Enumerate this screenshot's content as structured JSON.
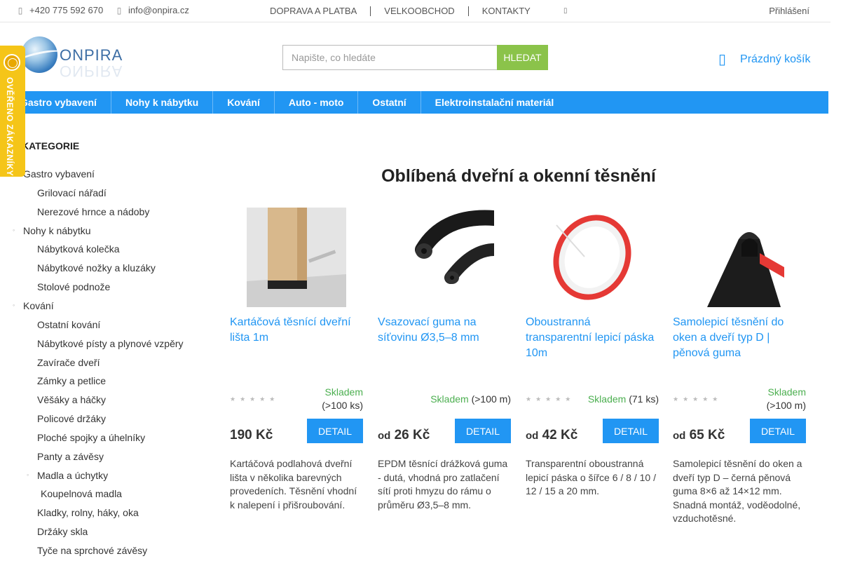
{
  "topbar": {
    "phone": "+420 775 592 670",
    "email": "info@onpira.cz",
    "nav": [
      "DOPRAVA A PLATBA",
      "VELKOOBCHOD",
      "KONTAKTY"
    ],
    "login": "Přihlášení"
  },
  "logo": {
    "name": "ONPIRA"
  },
  "search": {
    "placeholder": "Napište, co hledáte",
    "button": "HLEDAT"
  },
  "cart": {
    "label": "Prázdný košík"
  },
  "mainnav": [
    "Gastro vybavení",
    "Nohy k nábytku",
    "Kování",
    "Auto - moto",
    "Ostatní",
    "Elektroinstalační materiál"
  ],
  "badge": {
    "text": "OVĚŘENO ZÁKAZNÍKY"
  },
  "sidebar": {
    "heading": "KATEGORIE",
    "items": [
      {
        "label": "Gastro vybavení",
        "level": 0
      },
      {
        "label": "Grilovací nářadí",
        "level": 1
      },
      {
        "label": "Nerezové hrnce a nádoby",
        "level": 1
      },
      {
        "label": "Nohy k nábytku",
        "level": 0
      },
      {
        "label": "Nábytková kolečka",
        "level": 1
      },
      {
        "label": "Nábytkové nožky a kluzáky",
        "level": 1
      },
      {
        "label": "Stolové podnože",
        "level": 1
      },
      {
        "label": "Kování",
        "level": 0
      },
      {
        "label": "Ostatní kování",
        "level": 1
      },
      {
        "label": "Nábytkové písty a plynové vzpěry",
        "level": 1
      },
      {
        "label": "Zavírače dveří",
        "level": 1
      },
      {
        "label": "Zámky a petlice",
        "level": 1
      },
      {
        "label": "Věšáky a háčky",
        "level": 1
      },
      {
        "label": "Policové držáky",
        "level": 1
      },
      {
        "label": "Ploché spojky a úhelníky",
        "level": 1
      },
      {
        "label": "Panty a závěsy",
        "level": 1
      },
      {
        "label": "Madla a úchytky",
        "level": 1
      },
      {
        "label": "Koupelnová madla",
        "level": 2
      },
      {
        "label": "Kladky, rolny, háky, oka",
        "level": 1
      },
      {
        "label": "Držáky skla",
        "level": 1
      },
      {
        "label": "Tyče na sprchové závěsy",
        "level": 1
      }
    ]
  },
  "content": {
    "title": "Oblíbená dveřní a okenní těsnění",
    "products": [
      {
        "name": "Kartáčová těsnící dveřní lišta 1m",
        "stock_status": "Skladem",
        "stock_qty": "(>100 ks)",
        "price_prefix": "",
        "price": "190 Kč",
        "detail": "DETAIL",
        "description": "Kartáčová podlahová dveřní lišta v několika barevných provedeních. Těsnění vhodní k nalepení i přišroubování.",
        "rating_stars": 5,
        "show_stars": true
      },
      {
        "name": "Vsazovací guma na síťovinu Ø3,5–8 mm",
        "stock_status": "Skladem",
        "stock_qty": "(>100 m)",
        "price_prefix": "od",
        "price": "26 Kč",
        "detail": "DETAIL",
        "description": "EPDM těsnící drážková guma - dutá, vhodná pro zatlačení sítí proti hmyzu do rámu o průměru Ø3,5–8 mm.",
        "rating_stars": 0,
        "show_stars": false
      },
      {
        "name": "Oboustranná transparentní lepicí páska 10m",
        "stock_status": "Skladem",
        "stock_qty": "(71 ks)",
        "price_prefix": "od",
        "price": "42 Kč",
        "detail": "DETAIL",
        "description": "Transparentní oboustranná lepicí páska o šířce 6 / 8 / 10 / 12 / 15 a 20 mm.",
        "rating_stars": 5,
        "show_stars": true
      },
      {
        "name": "Samolepicí těsnění do oken a dveří typ D | pěnová guma",
        "stock_status": "Skladem",
        "stock_qty": "(>100 m)",
        "price_prefix": "od",
        "price": "65 Kč",
        "detail": "DETAIL",
        "description": "Samolepicí těsnění do oken a dveří typ D – černá pěnová guma 8×6 až 14×12 mm. Snadná montáž, voděodolné, vzduchotěsné.",
        "rating_stars": 5,
        "show_stars": true
      }
    ]
  },
  "colors": {
    "primary": "#2196f3",
    "accent_green": "#8bc34a",
    "stock_green": "#4caf50",
    "badge_yellow": "#f5c518"
  }
}
